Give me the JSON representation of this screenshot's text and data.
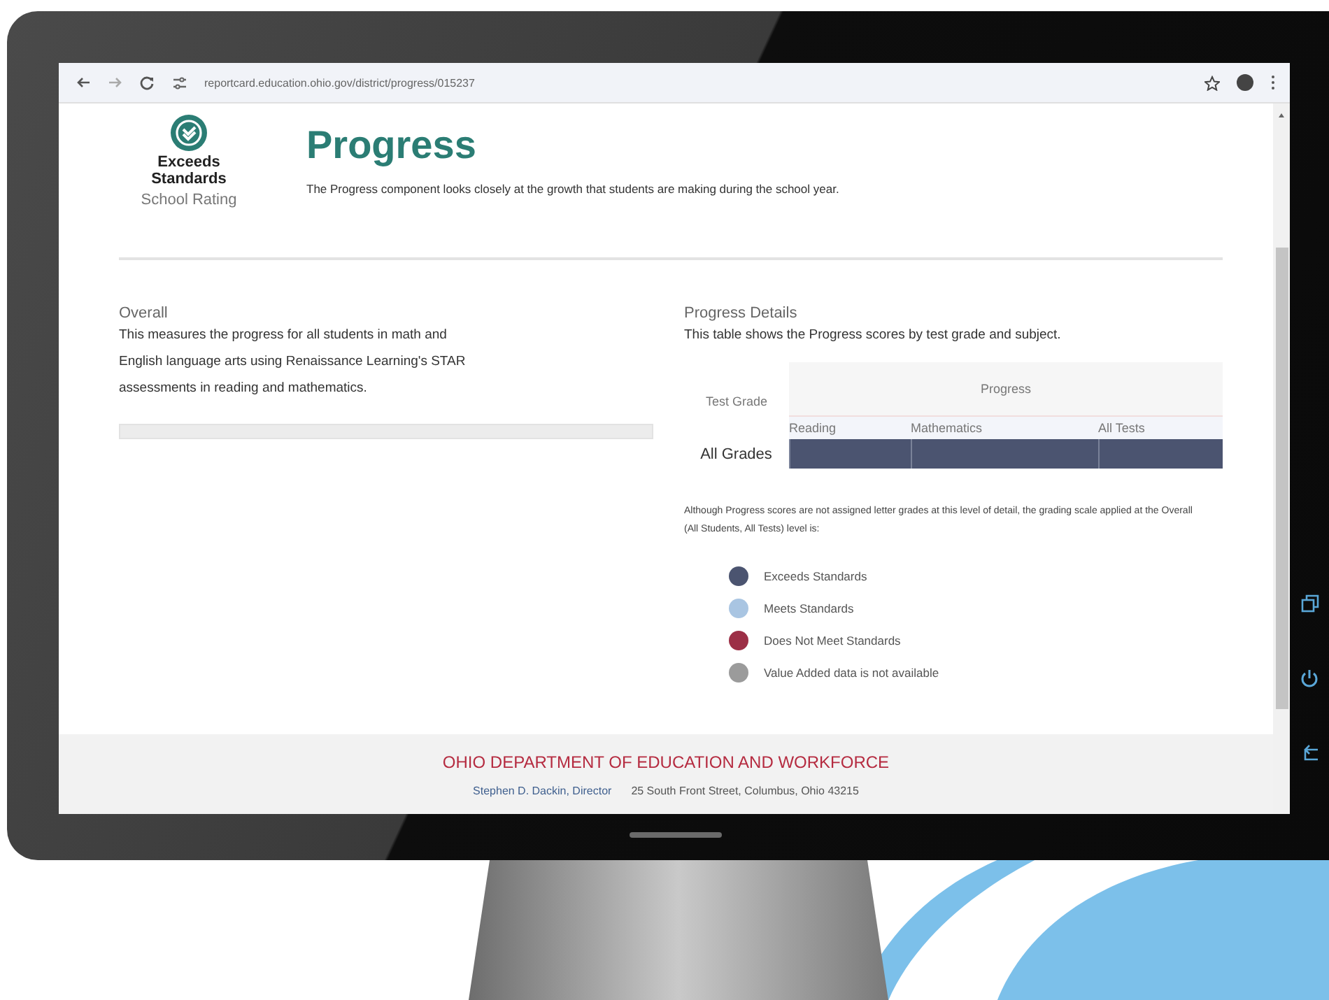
{
  "browser": {
    "url": "reportcard.education.ohio.gov/district/progress/015237"
  },
  "rating": {
    "label": "Exceeds Standards",
    "caption": "School Rating"
  },
  "header": {
    "title": "Progress",
    "description": "The Progress component looks closely at the growth that students are making during the school year."
  },
  "overall": {
    "heading": "Overall",
    "text": "This measures the progress for all students in math and English language arts using Renaissance Learning's STAR assessments in reading and mathematics."
  },
  "details": {
    "heading": "Progress Details",
    "text": "This table shows the Progress scores by test grade and subject.",
    "table": {
      "row_header": "Test Grade",
      "group_header": "Progress",
      "columns": [
        "Reading",
        "Mathematics",
        "All Tests"
      ],
      "rows": [
        {
          "label": "All Grades",
          "cells": [
            {
              "color": "#4b5470"
            },
            {
              "color": "#4b5470"
            },
            {
              "color": "#4b5470"
            }
          ]
        }
      ]
    },
    "note": "Although Progress scores are not assigned letter grades at this level of detail, the grading scale applied at the Overall (All Students, All Tests) level is:",
    "legend": [
      {
        "label": "Exceeds Standards",
        "color": "#4b5470"
      },
      {
        "label": "Meets Standards",
        "color": "#a9c5e2"
      },
      {
        "label": "Does Not Meet Standards",
        "color": "#9c2f46"
      },
      {
        "label": "Value Added data is not available",
        "color": "#9b9b9b"
      }
    ]
  },
  "footer": {
    "title": "OHIO DEPARTMENT OF EDUCATION AND WORKFORCE",
    "director": "Stephen D. Dackin, Director",
    "address": "25 South Front Street, Columbus, Ohio 43215"
  }
}
